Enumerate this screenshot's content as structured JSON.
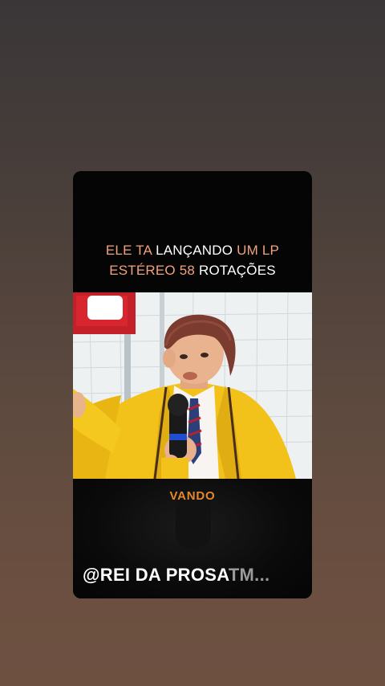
{
  "caption": {
    "line1_part1": "ELE TA",
    "line1_part2": "LANÇANDO",
    "line1_part3": "UM LP",
    "line2_part1": "ESTÉREO",
    "line2_part2": "58",
    "line2_part3": "ROTAÇÕES"
  },
  "speaker": {
    "name": "VANDO"
  },
  "watermark": {
    "handle": "@REI DA PROSA",
    "suffix": "TM..."
  },
  "colors": {
    "caption_highlight": "#f2a27a",
    "speaker_label": "#e7872a",
    "card_background": "#050505"
  }
}
